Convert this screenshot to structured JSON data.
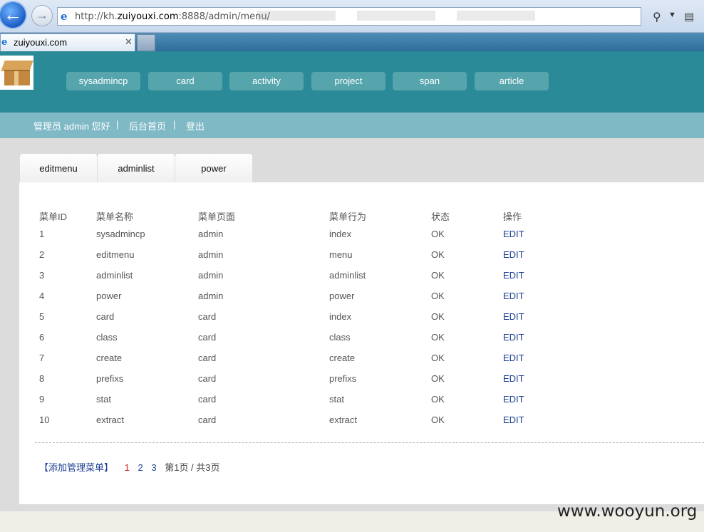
{
  "browser": {
    "url_prefix": "http://kh.",
    "url_host": "zuiyouxi.com",
    "url_rest": ":8888/admin/menu/",
    "tab_title": "zuiyouxi.com"
  },
  "header": {
    "menu": [
      "sysadmincp",
      "card",
      "activity",
      "project",
      "span",
      "article"
    ]
  },
  "subbar": {
    "greeting": "管理员 admin 您好",
    "sep": "|",
    "home": "后台首页",
    "logout": "登出"
  },
  "content_tabs": [
    "editmenu",
    "adminlist",
    "power"
  ],
  "table": {
    "headers": [
      "菜单ID",
      "菜单名称",
      "菜单页面",
      "菜单行为",
      "状态",
      "操作"
    ],
    "rows": [
      [
        "1",
        "sysadmincp",
        "admin",
        "index",
        "OK",
        "EDIT"
      ],
      [
        "2",
        "editmenu",
        "admin",
        "menu",
        "OK",
        "EDIT"
      ],
      [
        "3",
        "adminlist",
        "admin",
        "adminlist",
        "OK",
        "EDIT"
      ],
      [
        "4",
        "power",
        "admin",
        "power",
        "OK",
        "EDIT"
      ],
      [
        "5",
        "card",
        "card",
        "index",
        "OK",
        "EDIT"
      ],
      [
        "6",
        "class",
        "card",
        "class",
        "OK",
        "EDIT"
      ],
      [
        "7",
        "create",
        "card",
        "create",
        "OK",
        "EDIT"
      ],
      [
        "8",
        "prefixs",
        "card",
        "prefixs",
        "OK",
        "EDIT"
      ],
      [
        "9",
        "stat",
        "card",
        "stat",
        "OK",
        "EDIT"
      ],
      [
        "10",
        "extract",
        "card",
        "extract",
        "OK",
        "EDIT"
      ]
    ]
  },
  "pager": {
    "add": "【添加管理菜单】",
    "pages": [
      "1",
      "2",
      "3"
    ],
    "info": "第1页 / 共3页"
  },
  "watermark": "www.wooyun.org"
}
